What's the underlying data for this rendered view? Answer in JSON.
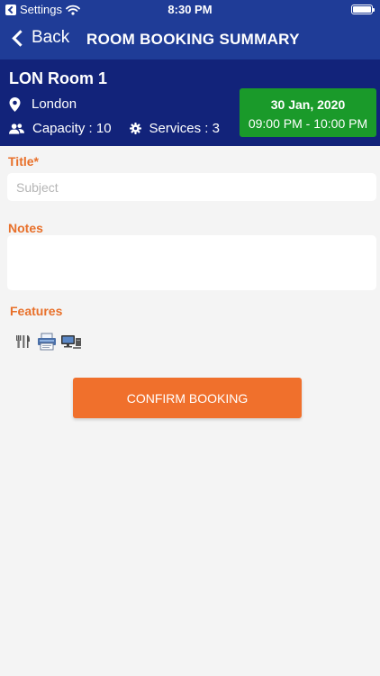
{
  "status": {
    "carrier": "Settings",
    "time": "8:30 PM"
  },
  "nav": {
    "back_label": "Back",
    "title": "ROOM BOOKING SUMMARY"
  },
  "room": {
    "name": "LON Room 1",
    "location": "London",
    "capacity": "Capacity : 10",
    "services": "Services : 3",
    "date": "30 Jan, 2020",
    "time_range": "09:00 PM - 10:00 PM"
  },
  "form": {
    "title_label": "Title*",
    "title_placeholder": "Subject",
    "title_value": "",
    "notes_label": "Notes",
    "notes_value": "",
    "features_label": "Features",
    "features": [
      "cutlery-icon",
      "printer-icon",
      "computer-icon"
    ]
  },
  "actions": {
    "confirm_label": "CONFIRM BOOKING"
  },
  "colors": {
    "navbar": "#1f3c97",
    "header": "#12237a",
    "date_box": "#1a9a2a",
    "accent": "#f0702c"
  }
}
